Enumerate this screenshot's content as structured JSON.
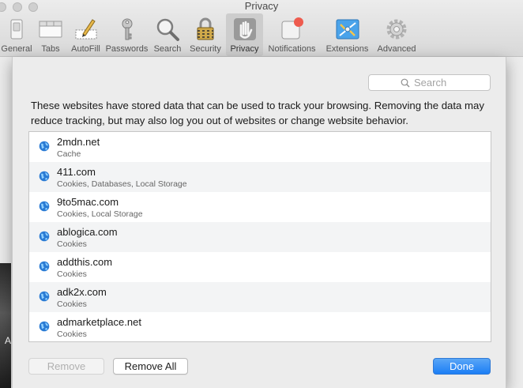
{
  "window": {
    "title": "Privacy"
  },
  "toolbar": {
    "items": [
      {
        "label": "General",
        "icon": "general-switch-icon"
      },
      {
        "label": "Tabs",
        "icon": "tabs-icon"
      },
      {
        "label": "AutoFill",
        "icon": "autofill-pencil-icon"
      },
      {
        "label": "Passwords",
        "icon": "key-icon"
      },
      {
        "label": "Search",
        "icon": "magnifier-icon"
      },
      {
        "label": "Security",
        "icon": "padlock-icon"
      },
      {
        "label": "Privacy",
        "icon": "hand-icon",
        "selected": true
      },
      {
        "label": "Notifications",
        "icon": "notifications-badge-icon"
      },
      {
        "label": "Extensions",
        "icon": "puzzle-icon"
      },
      {
        "label": "Advanced",
        "icon": "gear-icon"
      }
    ]
  },
  "sheet": {
    "search_placeholder": "Search",
    "description": "These websites have stored data that can be used to track your browsing. Removing the data may reduce tracking, but may also log you out of websites or change website behavior.",
    "sites": [
      {
        "name": "2mdn.net",
        "data": "Cache"
      },
      {
        "name": "411.com",
        "data": "Cookies, Databases, Local Storage"
      },
      {
        "name": "9to5mac.com",
        "data": "Cookies, Local Storage"
      },
      {
        "name": "ablogica.com",
        "data": "Cookies"
      },
      {
        "name": "addthis.com",
        "data": "Cookies"
      },
      {
        "name": "adk2x.com",
        "data": "Cookies"
      },
      {
        "name": "admarketplace.net",
        "data": "Cookies"
      }
    ],
    "buttons": {
      "remove": "Remove",
      "remove_all": "Remove All",
      "done": "Done"
    }
  },
  "background": {
    "partial_letter": "A"
  },
  "colors": {
    "accent": "#1b7ef5",
    "selected_toolbar": "#cdcdcd",
    "globe": "#2a7bd4"
  }
}
